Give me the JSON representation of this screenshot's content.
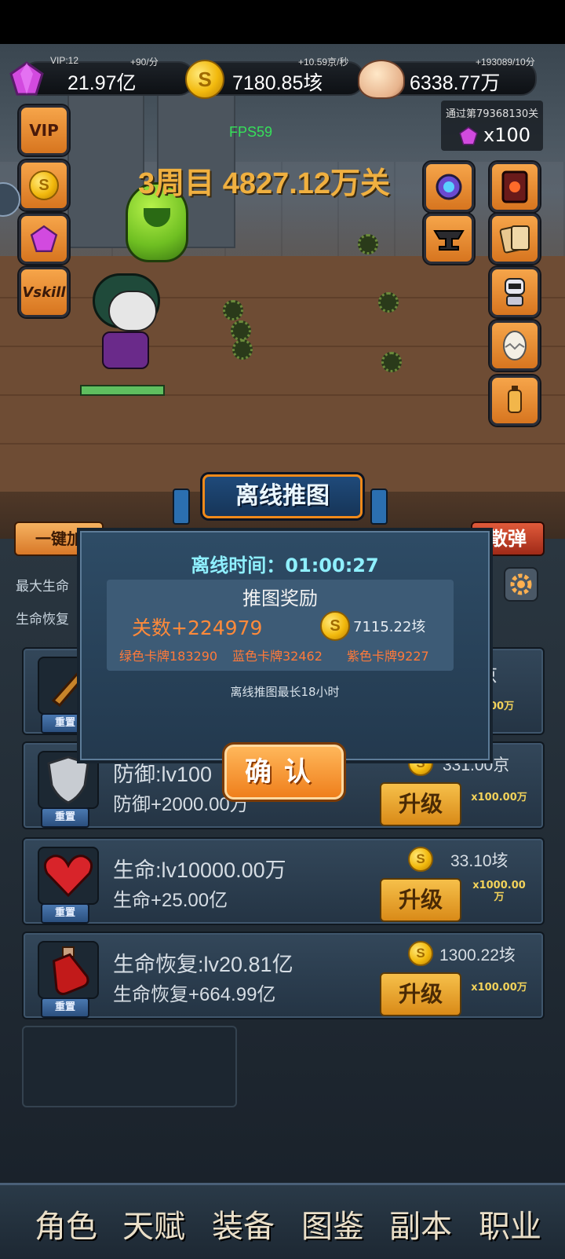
{
  "hud": {
    "vip_label": "VIP:12",
    "gem_rate": "+90/分",
    "gem_value": "21.97亿",
    "coin_rate": "+10.59京/秒",
    "coin_value": "7180.85垓",
    "skull_rate": "+193089/10分",
    "skull_value": "6338.77万",
    "fps": "FPS59",
    "stage_title": "3周目 4827.12万关",
    "pass_notice": "通过第79368130关",
    "pass_reward": "x100",
    "side_left_buttons": [
      "VIP",
      "coin-shop",
      "gem-shop",
      "Vskill"
    ],
    "side_right_buttons": [
      "eye-boss",
      "card-deck",
      "anvil",
      "cards",
      "robot",
      "egg",
      "lantern"
    ]
  },
  "panel": {
    "auto_btn": "一键加",
    "scatter_btn": "散弹",
    "stat_max_hp_label": "最大生命",
    "stat_regen_label": "生命恢复",
    "cards": [
      {
        "icon": "sword-icon",
        "line1": "",
        "line2": "",
        "cost": "京",
        "multiplier": "0.00万",
        "reset": "重置"
      },
      {
        "icon": "shield-icon",
        "line1": "防御:lv100",
        "line2": "防御+2000.00万",
        "cost": "331.00京",
        "upgrade": "升级",
        "multiplier": "x100.00万",
        "reset": "重置"
      },
      {
        "icon": "heart-icon",
        "line1": "生命:lv10000.00万",
        "line2": "生命+25.00亿",
        "cost": "33.10垓",
        "upgrade": "升级",
        "multiplier": "x1000.00\n万",
        "reset": "重置"
      },
      {
        "icon": "potion-icon",
        "line1": "生命恢复:lv20.81亿",
        "line2": "生命恢复+664.99亿",
        "cost": "1300.22垓",
        "upgrade": "升级",
        "multiplier": "x100.00万",
        "reset": "重置"
      }
    ]
  },
  "nav": {
    "items": [
      "角色",
      "天赋",
      "装备",
      "图鉴",
      "副本",
      "职业"
    ]
  },
  "dialog": {
    "title": "离线推图",
    "offline_time": "离线时间：01:00:27",
    "reward_header": "推图奖励",
    "levels_gain": "关数+224979",
    "coin_gain": "7115.22垓",
    "green_cards": "绿色卡牌183290",
    "blue_cards": "蓝色卡牌32462",
    "purple_cards": "紫色卡牌9227",
    "note": "离线推图最长18小时",
    "confirm": "确认"
  },
  "colors": {
    "accent_orange": "#ef7f1c",
    "dialog_blue": "#2e4c66",
    "coin_gold": "#f2b90d",
    "stage_gold": "#f0b040",
    "green_text": "#36e05a"
  }
}
